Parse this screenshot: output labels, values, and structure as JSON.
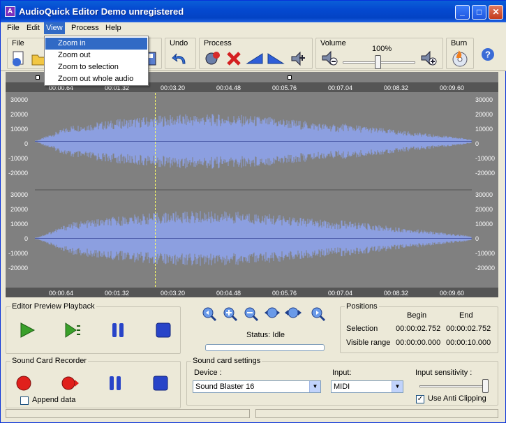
{
  "window": {
    "title": "AudioQuick Editor Demo unregistered",
    "icon_letter": "A"
  },
  "menu": {
    "items": [
      "File",
      "Edit",
      "View",
      "Process",
      "Help"
    ]
  },
  "view_menu": {
    "items": [
      "Zoom in",
      "Zoom out",
      "Zoom to selection",
      "Zoom out whole audio"
    ],
    "selected_index": 0
  },
  "toolbar": {
    "file_label": "File",
    "undo_label": "Undo",
    "process_label": "Process",
    "volume_label": "Volume",
    "volume_value": "100%",
    "burn_label": "Burn"
  },
  "waveform": {
    "time_ticks": [
      "00:00.64",
      "00:01.32",
      "00:03.20",
      "00:04.48",
      "00:05.76",
      "00:07.04",
      "00:08.32",
      "00:09.60"
    ],
    "y_ticks": [
      "30000",
      "20000",
      "10000",
      "0",
      "-10000",
      "-20000"
    ],
    "wave_color": "#8c9fe0",
    "cursor_color": "#ffff66",
    "background_color": "#808080"
  },
  "preview": {
    "label": "Editor Preview Playback"
  },
  "recorder": {
    "label": "Sound Card Recorder",
    "append_label": "Append data",
    "append_checked": false
  },
  "zoom_status": {
    "status_text": "Status: Idle"
  },
  "positions": {
    "label": "Positions",
    "col_begin": "Begin",
    "col_end": "End",
    "selection_label": "Selection",
    "selection_begin": "00:00:02.752",
    "selection_end": "00:00:02.752",
    "visible_label": "Visible range",
    "visible_begin": "00:00:00.000",
    "visible_end": "00:00:10.000"
  },
  "soundcard": {
    "label": "Sound card settings",
    "device_label": "Device :",
    "device_value": "Sound Blaster 16",
    "input_label": "Input:",
    "input_value": "MIDI",
    "sensitivity_label": "Input sensitivity :",
    "anti_clipping_label": "Use Anti Clipping",
    "anti_clipping_checked": true
  }
}
